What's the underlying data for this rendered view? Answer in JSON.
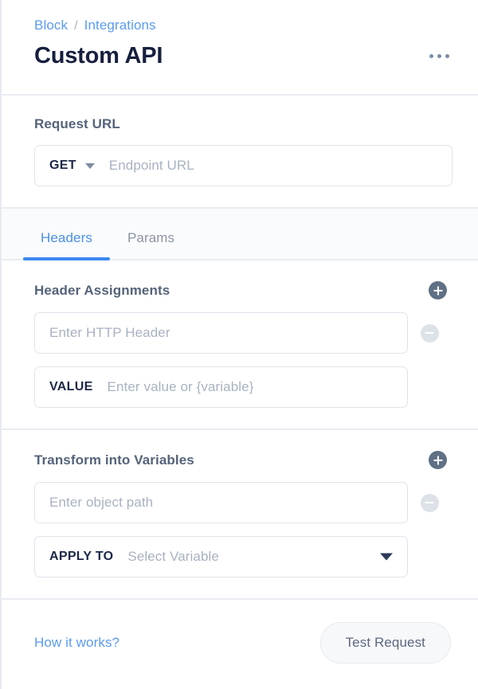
{
  "header": {
    "breadcrumb": {
      "parent": "Block",
      "separator": "/",
      "current": "Integrations"
    },
    "title": "Custom API",
    "menu_icon": "kebab-menu-icon"
  },
  "request": {
    "label": "Request URL",
    "method": "GET",
    "method_caret": "chevron-down-icon",
    "url_placeholder": "Endpoint URL"
  },
  "tabs": [
    {
      "label": "Headers",
      "active": true
    },
    {
      "label": "Params",
      "active": false
    }
  ],
  "headers_section": {
    "label": "Header Assignments",
    "add_icon": "plus-circle-icon",
    "remove_icon": "minus-circle-icon",
    "name_placeholder": "Enter HTTP Header",
    "value_prefix": "VALUE",
    "value_placeholder": "Enter value or {variable}"
  },
  "transform_section": {
    "label": "Transform into Variables",
    "add_icon": "plus-circle-icon",
    "remove_icon": "minus-circle-icon",
    "path_placeholder": "Enter object path",
    "apply_prefix": "APPLY TO",
    "apply_placeholder": "Select Variable",
    "apply_caret": "chevron-down-icon"
  },
  "footer": {
    "how_it_works": "How it works?",
    "test_button": "Test Request"
  },
  "colors": {
    "link_blue": "#5b9bf0",
    "tab_active": "#4a90e8",
    "underline": "#3b88f0",
    "title": "#161f3e",
    "label": "#55637a",
    "placeholder": "#a8b2c1",
    "plus_circle": "#5f7085",
    "minus_circle": "#dde2e9",
    "border": "#dfe4eb"
  }
}
